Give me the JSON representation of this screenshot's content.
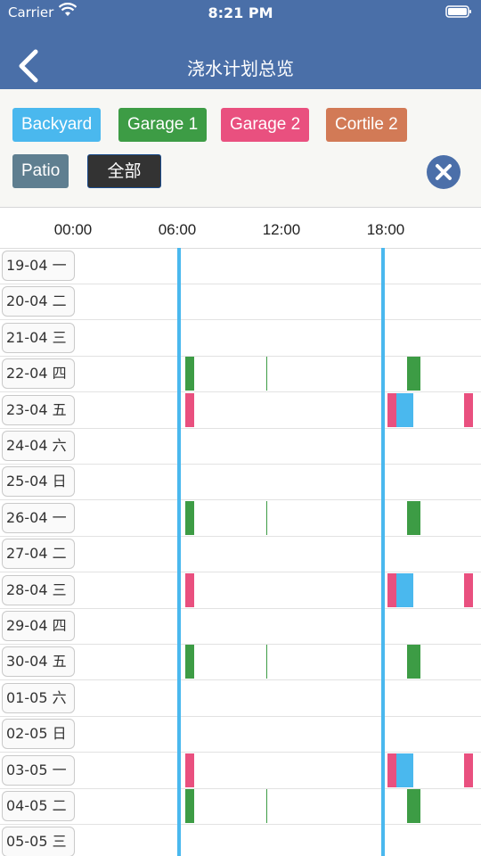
{
  "status_bar": {
    "carrier": "Carrier",
    "time": "8:21 PM"
  },
  "header": {
    "title": "浇水计划总览"
  },
  "filters": [
    {
      "label": "Backyard",
      "color": "#4ab8ee"
    },
    {
      "label": "Garage 1",
      "color": "#3d9c45"
    },
    {
      "label": "Garage 2",
      "color": "#e9507f"
    },
    {
      "label": "Cortile 2",
      "color": "#d27a56"
    },
    {
      "label": "Patio",
      "color": "#5f7f90"
    },
    {
      "label": "全部",
      "color": "#333333",
      "selected": true
    }
  ],
  "hours": [
    "00:00",
    "06:00",
    "12:00",
    "18:00"
  ],
  "now_marker_color": "#4ab8ee",
  "days": [
    {
      "label": "19-04 一",
      "events": []
    },
    {
      "label": "20-04 二",
      "events": []
    },
    {
      "label": "21-04 三",
      "events": []
    },
    {
      "label": "22-04 四",
      "events": [
        {
          "zone": "Garage 1",
          "start": 6.25,
          "end": 6.75
        },
        {
          "zone": "Garage 1",
          "start": 10.9,
          "end": 11.0
        },
        {
          "zone": "Garage 1",
          "start": 19.0,
          "end": 19.8
        }
      ]
    },
    {
      "label": "23-04 五",
      "events": [
        {
          "zone": "Garage 2",
          "start": 6.25,
          "end": 6.75
        },
        {
          "zone": "Garage 2",
          "start": 17.9,
          "end": 18.4
        },
        {
          "zone": "Backyard",
          "start": 18.4,
          "end": 19.4
        },
        {
          "zone": "Garage 2",
          "start": 22.3,
          "end": 22.8
        }
      ]
    },
    {
      "label": "24-04 六",
      "events": []
    },
    {
      "label": "25-04 日",
      "events": []
    },
    {
      "label": "26-04 一",
      "events": [
        {
          "zone": "Garage 1",
          "start": 6.25,
          "end": 6.75
        },
        {
          "zone": "Garage 1",
          "start": 10.9,
          "end": 11.0
        },
        {
          "zone": "Garage 1",
          "start": 19.0,
          "end": 19.8
        }
      ]
    },
    {
      "label": "27-04 二",
      "events": []
    },
    {
      "label": "28-04 三",
      "events": [
        {
          "zone": "Garage 2",
          "start": 6.25,
          "end": 6.75
        },
        {
          "zone": "Garage 2",
          "start": 17.9,
          "end": 18.4
        },
        {
          "zone": "Backyard",
          "start": 18.4,
          "end": 19.4
        },
        {
          "zone": "Garage 2",
          "start": 22.3,
          "end": 22.8
        }
      ]
    },
    {
      "label": "29-04 四",
      "events": []
    },
    {
      "label": "30-04 五",
      "events": [
        {
          "zone": "Garage 1",
          "start": 6.25,
          "end": 6.75
        },
        {
          "zone": "Garage 1",
          "start": 10.9,
          "end": 11.0
        },
        {
          "zone": "Garage 1",
          "start": 19.0,
          "end": 19.8
        }
      ]
    },
    {
      "label": "01-05 六",
      "events": []
    },
    {
      "label": "02-05 日",
      "events": []
    },
    {
      "label": "03-05 一",
      "events": [
        {
          "zone": "Garage 2",
          "start": 6.25,
          "end": 6.75
        },
        {
          "zone": "Garage 2",
          "start": 17.9,
          "end": 18.4
        },
        {
          "zone": "Backyard",
          "start": 18.4,
          "end": 19.4
        },
        {
          "zone": "Garage 2",
          "start": 22.3,
          "end": 22.8
        }
      ]
    },
    {
      "label": "04-05 二",
      "events": [
        {
          "zone": "Garage 1",
          "start": 6.25,
          "end": 6.75
        },
        {
          "zone": "Garage 1",
          "start": 10.9,
          "end": 11.0
        },
        {
          "zone": "Garage 1",
          "start": 19.0,
          "end": 19.8
        }
      ]
    },
    {
      "label": "05-05 三",
      "events": []
    }
  ],
  "now_lines": [
    5.85,
    17.6
  ]
}
